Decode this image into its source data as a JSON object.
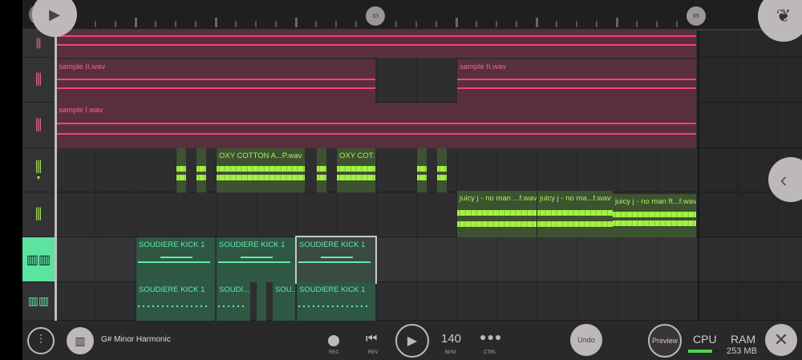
{
  "ruler": {
    "markers": [
      "33",
      "65"
    ]
  },
  "tracks": [
    {
      "name": "audio-track-1",
      "color": "#f06a92"
    },
    {
      "name": "audio-track-2",
      "color": "#f06a92"
    },
    {
      "name": "audio-track-3",
      "color": "#f06a92"
    },
    {
      "name": "audio-track-4",
      "color": "#a9ef5c"
    },
    {
      "name": "audio-track-5",
      "color": "#a9ef5c"
    },
    {
      "name": "piano-track-1",
      "color": "#66e8ab"
    },
    {
      "name": "piano-track-2",
      "color": "#66e8ab"
    }
  ],
  "clips": {
    "sample2a": "sample II.wav",
    "sample2b": "sample II.wav",
    "sample1": "sample I.wav",
    "oxy1": "OXY COTTON A...P.wav",
    "oxy2": "OXY COT...",
    "juicy1": "juicy j - no man ...f.wav",
    "juicy2": "juicy j - no ma...f.wav",
    "juicy3": "juicy j - no man ft...f.wav",
    "kick1": "SOUDIERE KICK 1",
    "kick2": "SOUDIERE KICK 1",
    "kick3": "SOUDIERE KICK 1",
    "kick4": "SOUDIERE KICK 1",
    "kick5": "SOUDI...",
    "kick6": "SOU...",
    "kick7": "SOUDIERE KICK 1"
  },
  "bottom": {
    "scale": "G# Minor Harmonic",
    "rec": "REC",
    "rev": "REV",
    "bpm": "140",
    "bpm_label": "BPM",
    "ctrl": "CTRL",
    "undo": "Undo",
    "preview": "Preview",
    "cpu": "CPU",
    "cpu_load": 0.75,
    "ram": "RAM",
    "ram_value": "253 MB"
  }
}
